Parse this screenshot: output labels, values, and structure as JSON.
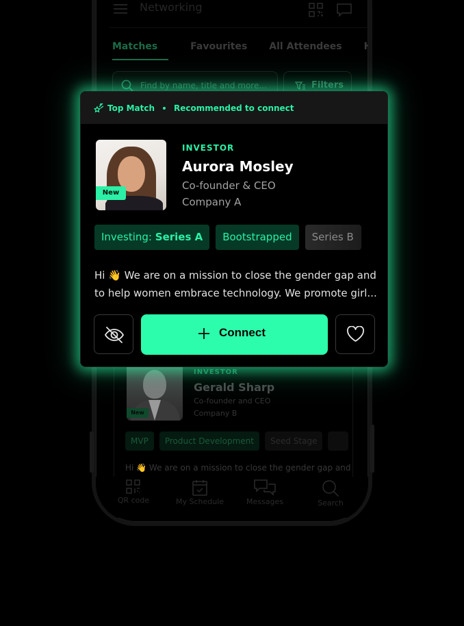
{
  "app": {
    "title": "Networking",
    "tabs": [
      {
        "label": "Matches",
        "active": true
      },
      {
        "label": "Favourites",
        "active": false
      },
      {
        "label": "All Attendees",
        "active": false
      },
      {
        "label": "Hidden",
        "active": false
      }
    ],
    "search": {
      "placeholder": "Find by name, title and more..."
    },
    "filters_label": "Filters"
  },
  "featured_card": {
    "banner": {
      "label": "Top Match",
      "separator": "•",
      "subtitle": "Recommended to connect"
    },
    "badge": "New",
    "role": "INVESTOR",
    "name": "Aurora Mosley",
    "title": "Co-founder & CEO",
    "company": "Company A",
    "tags": [
      {
        "prefix": "Investing:",
        "value": "Series A"
      },
      {
        "value": "Bootstrapped"
      },
      {
        "value": "Series B"
      }
    ],
    "bio_line1": "Hi 👋  We are on a mission to close the gender gap and",
    "bio_line2": "to help women embrace technology. We promote girl...",
    "actions": {
      "connect_label": "Connect"
    },
    "colors": {
      "accent": "#2cfdac",
      "tag_bg": "#063a27"
    }
  },
  "second_card": {
    "badge": "New",
    "role": "INVESTOR",
    "name": "Gerald Sharp",
    "title": "Co-founder and CEO",
    "company": "Company B",
    "tags": [
      "MVP",
      "Product Development",
      "Seed Stage"
    ],
    "bio": "Hi 👋  We are on a mission to close the gender gap and"
  },
  "bottom_nav": [
    {
      "label": "QR code",
      "icon": "qr-code-icon"
    },
    {
      "label": "My Schedule",
      "icon": "calendar-icon"
    },
    {
      "label": "Messages",
      "icon": "messages-icon"
    },
    {
      "label": "Search",
      "icon": "search-icon"
    }
  ]
}
